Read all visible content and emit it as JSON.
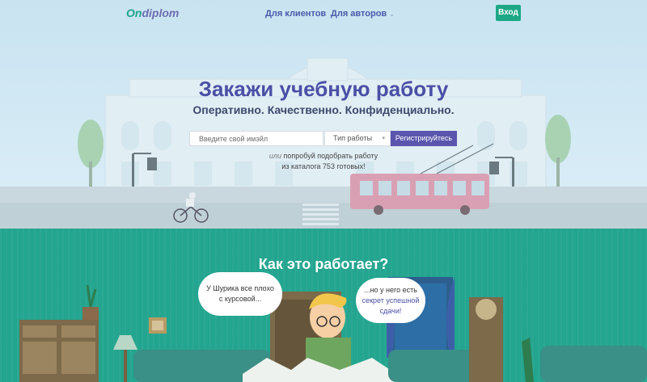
{
  "nav": {
    "logo_part1": "On",
    "logo_part2": "diplom",
    "link_clients": "Для клиентов",
    "link_authors": "Для авторов",
    "login": "Вход"
  },
  "hero": {
    "title": "Закажи учебную работу",
    "subtitle": "Оперативно. Качественно. Конфиденциально.",
    "email_placeholder": "Введите свой имэйл",
    "type_select": "Тип работы",
    "register_button": "Регистрируйтесь",
    "hint_or": "или",
    "hint_line1": "попробуй подобрать работу",
    "hint_line2": "из каталога 753 готовых!"
  },
  "how": {
    "title": "Как это работает?",
    "bubble_left": "У Шурика все плохо с курсовой...",
    "bubble_right_1": "...но у него есть",
    "bubble_right_2": "секрет успешной",
    "bubble_right_3": "сдачи!"
  },
  "colors": {
    "brand_green": "#1ca886",
    "brand_purple": "#5a55ad",
    "section_teal": "#23a58f"
  }
}
